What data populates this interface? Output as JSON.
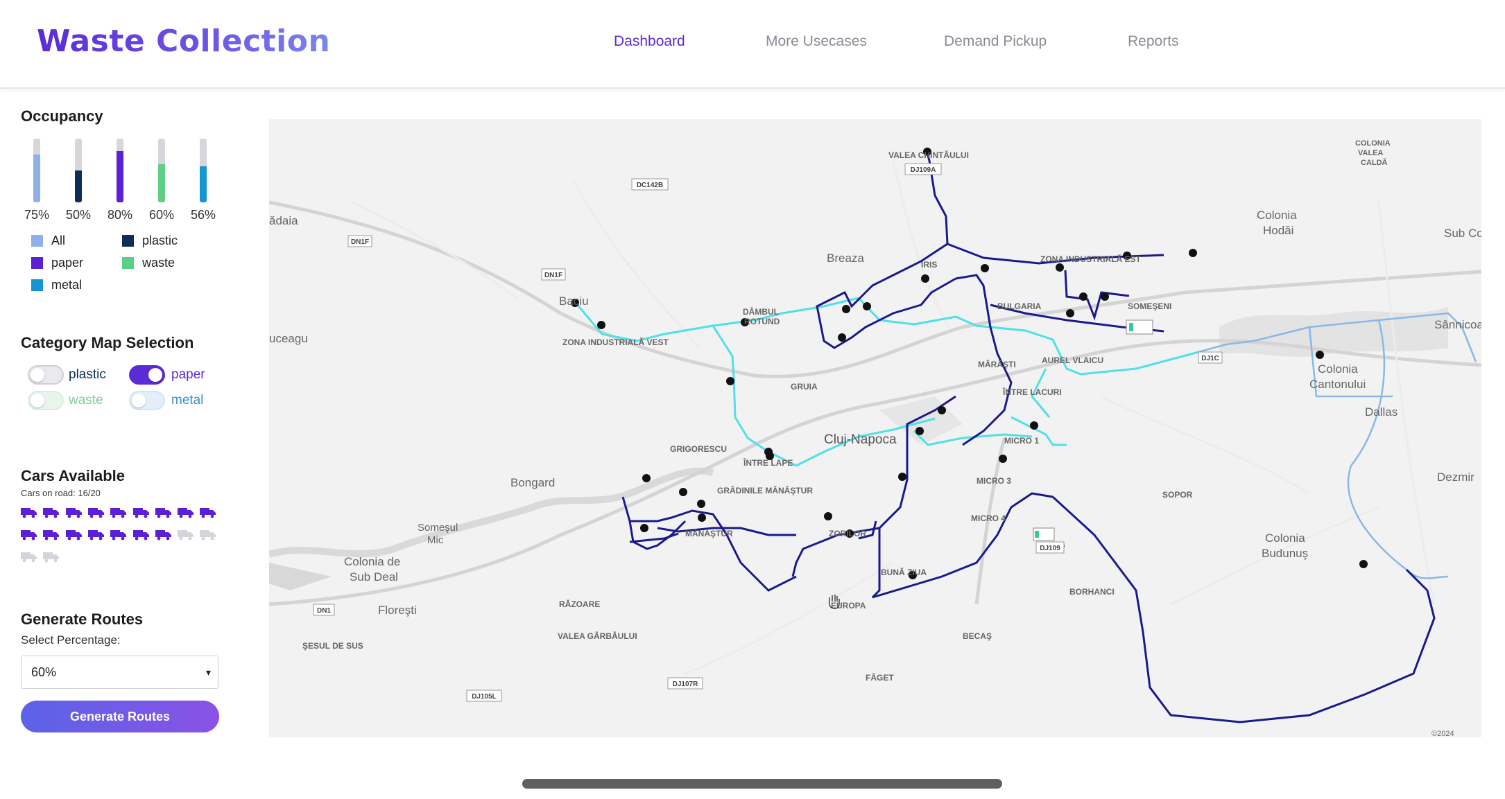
{
  "header": {
    "brand": "Waste Collection",
    "nav": [
      "Dashboard",
      "More Usecases",
      "Demand Pickup",
      "Reports"
    ],
    "active_nav": "Dashboard"
  },
  "occupancy": {
    "title": "Occupancy",
    "bars": [
      {
        "label": "75%",
        "value": 75,
        "color": "#8fb0ea"
      },
      {
        "label": "50%",
        "value": 50,
        "color": "#0f2d55"
      },
      {
        "label": "80%",
        "value": 80,
        "color": "#5b1fd6"
      },
      {
        "label": "60%",
        "value": 60,
        "color": "#5fcf86"
      },
      {
        "label": "56%",
        "value": 56,
        "color": "#1596d0"
      }
    ],
    "legend": [
      {
        "label": "All",
        "color": "#8fb0ea"
      },
      {
        "label": "plastic",
        "color": "#0f2d55"
      },
      {
        "label": "paper",
        "color": "#5b1fd6"
      },
      {
        "label": "waste",
        "color": "#5fcf86"
      },
      {
        "label": "metal",
        "color": "#1596d0"
      }
    ]
  },
  "category": {
    "title": "Category Map Selection",
    "toggles": [
      {
        "label": "plastic",
        "on": false,
        "color": "#0f2d55"
      },
      {
        "label": "paper",
        "on": true,
        "color": "#5b2bd6"
      },
      {
        "label": "waste",
        "on": false,
        "color": "#7fcf9a"
      },
      {
        "label": "metal",
        "on": false,
        "color": "#3b8fd0"
      }
    ]
  },
  "cars": {
    "title": "Cars Available",
    "subtitle": "Cars on road: 16/20",
    "on_road": 16,
    "total": 20,
    "active_color": "#5b1fd6",
    "inactive_color": "#d4d4da"
  },
  "routes": {
    "title": "Generate Routes",
    "select_label": "Select Percentage:",
    "selected": "60%",
    "button": "Generate Routes"
  },
  "map": {
    "places": [
      "VALEA CHINTĂULUI",
      "DJ109A",
      "DC142B",
      "Colonia Hodăi",
      "Sub Coa",
      "COLONIA VALEA CALDĂ",
      "ădaia",
      "DN1F",
      "Breaza",
      "IRIS",
      "ZONA INDUSTRIALĂ EST",
      "SOMEŞENI",
      "Baciu",
      "DN1F",
      "ZONA INDUSTRIALĂ VEST",
      "DÂMBUL ROTUND",
      "BULGARIA",
      "Sânnicoa",
      "uceagu",
      "DJ1C",
      "MĂRĂŞTI",
      "AUREL VLAICU",
      "Colonia Cantonului",
      "GRUIA",
      "ÎNTRE LACURI",
      "Dallas",
      "GRIGORESCU",
      "Cluj-Napoca",
      "MICRO 1",
      "ÎNTRE LAPE",
      "Dezmir",
      "Bongard",
      "GRĂDINILE MĂNĂŞTUR",
      "MICRO 3",
      "SOPOR",
      "Someşul Mic",
      "MĂNĂŞTUR",
      "ZORILOR",
      "MICRO 4",
      "DJ109",
      "Colonia Budunuş",
      "Colonia de Sub Deal",
      "Floreşti",
      "BUNĂ ZIUA",
      "BORHANCI",
      "DN1",
      "RĂZOARE",
      "EUROPA",
      "VALEA GÂRBĂULUI",
      "BECAŞ",
      "ŞESUL DE SUS",
      "FĂGET",
      "DJ107R",
      "DJ105L",
      "©2024"
    ],
    "route_colors": {
      "paper": "#1a1a8c",
      "metal": "#4fe0e8",
      "metal_outer": "#8ab7e6"
    }
  }
}
